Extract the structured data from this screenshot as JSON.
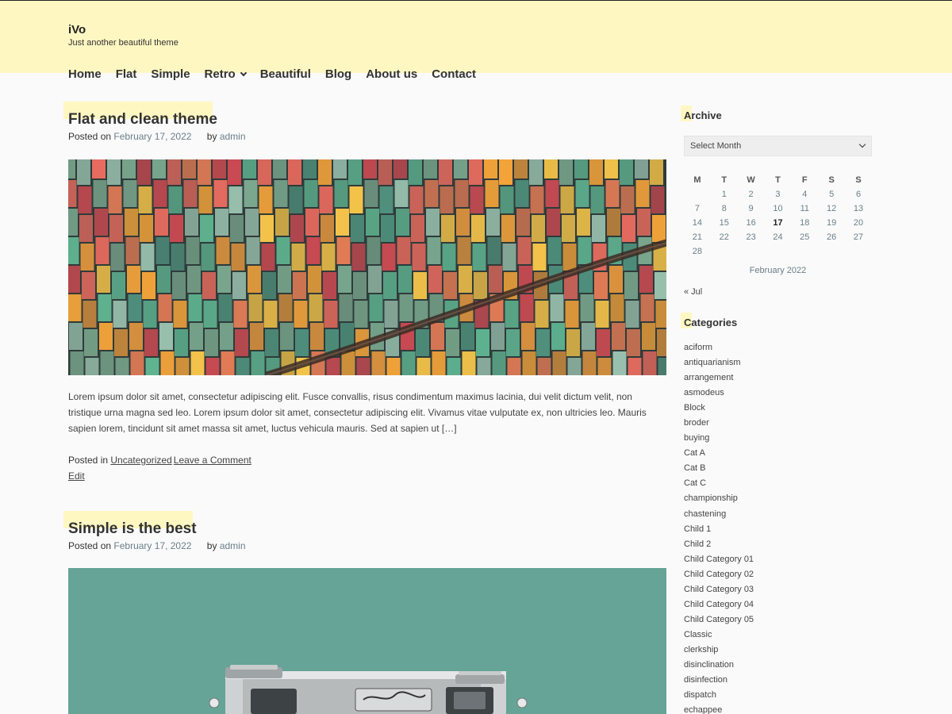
{
  "site": {
    "title": "iVo",
    "description": "Just another beautiful theme"
  },
  "nav": [
    {
      "label": "Home"
    },
    {
      "label": "Flat"
    },
    {
      "label": "Simple"
    },
    {
      "label": "Retro",
      "has_submenu": true
    },
    {
      "label": "Beautiful"
    },
    {
      "label": "Blog"
    },
    {
      "label": "About us"
    },
    {
      "label": "Contact"
    }
  ],
  "posts": [
    {
      "title": "Flat and clean theme",
      "posted_on_label": "Posted on",
      "date": "February 17, 2022",
      "by_label": "by",
      "author": "admin",
      "image": "colorful-bookshelf",
      "excerpt": "Lorem ipsum dolor sit amet, consectetur adipiscing elit. Fusce convallis, risus condimentum maximus lacinia, dui velit dictum velit, non tristique urna magna sed leo. Lorem ipsum dolor sit amet, consectetur adipiscing elit. Vivamus vitae vulputate ex, non ultricies leo. Mauris sapien lorem, tincidunt sit amet massa sit amet, luctus vehicula mauris. Sed at sapien ut […]",
      "posted_in_label": "Posted in",
      "category": "Uncategorized",
      "comment_link": "Leave a Comment",
      "edit_link": "Edit"
    },
    {
      "title": "Simple is the best",
      "posted_on_label": "Posted on",
      "date": "February 17, 2022",
      "by_label": "by",
      "author": "admin",
      "image": "vintage-camera-on-teal"
    }
  ],
  "sidebar": {
    "archive": {
      "title": "Archive",
      "select_value": "Select Month",
      "calendar": {
        "headers": [
          "M",
          "T",
          "W",
          "T",
          "F",
          "S",
          "S"
        ],
        "rows": [
          [
            "",
            "1",
            "2",
            "3",
            "4",
            "5",
            "6"
          ],
          [
            "7",
            "8",
            "9",
            "10",
            "11",
            "12",
            "13"
          ],
          [
            "14",
            "15",
            "16",
            "17",
            "18",
            "19",
            "20"
          ],
          [
            "21",
            "22",
            "23",
            "24",
            "25",
            "26",
            "27"
          ],
          [
            "28",
            "",
            "",
            "",
            "",
            "",
            ""
          ]
        ],
        "today": "17",
        "caption": "February 2022",
        "prev_link": "« Jul"
      }
    },
    "categories": {
      "title": "Categories",
      "items": [
        "aciform",
        "antiquarianism",
        "arrangement",
        "asmodeus",
        "Block",
        "broder",
        "buying",
        "Cat A",
        "Cat B",
        "Cat C",
        "championship",
        "chastening",
        "Child 1",
        "Child 2",
        "Child Category 01",
        "Child Category 02",
        "Child Category 03",
        "Child Category 04",
        "Child Category 05",
        "Classic",
        "clerkship",
        "disinclination",
        "disinfection",
        "dispatch",
        "echappee"
      ]
    }
  },
  "colors": {
    "highlight": "#fff7c2",
    "background": "#fafafa",
    "link": "#6b7f8a",
    "text": "#333333"
  }
}
